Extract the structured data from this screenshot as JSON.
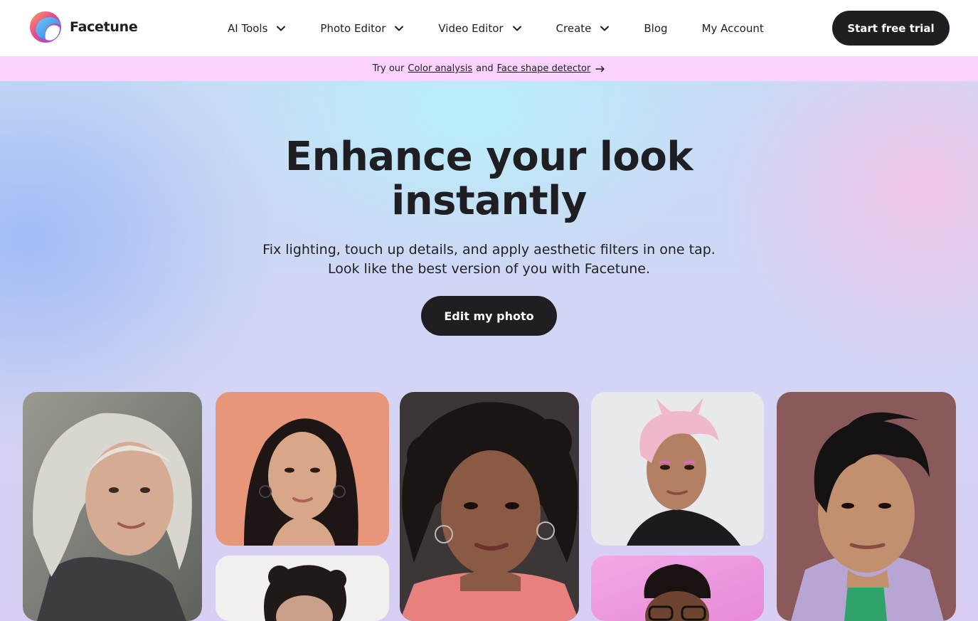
{
  "brand": {
    "name": "Facetune",
    "logo_icon": "facetune-logo-icon"
  },
  "nav": {
    "items": [
      {
        "label": "AI Tools",
        "has_dropdown": true
      },
      {
        "label": "Photo Editor",
        "has_dropdown": true
      },
      {
        "label": "Video Editor",
        "has_dropdown": true
      },
      {
        "label": "Create",
        "has_dropdown": true
      },
      {
        "label": "Blog",
        "has_dropdown": false
      },
      {
        "label": "My Account",
        "has_dropdown": false
      }
    ],
    "cta_label": "Start free trial"
  },
  "promo": {
    "prefix": "Try our",
    "link1": "Color analysis",
    "joiner": "and",
    "link2": "Face shape detector",
    "arrow_icon": "arrow-right-icon",
    "background": "#fbd3fc"
  },
  "hero": {
    "title_line1": "Enhance your look",
    "title_line2": "instantly",
    "subtitle_line1": "Fix lighting, touch up details, and apply aesthetic filters in one tap.",
    "subtitle_line2": "Look like the best version of you with Facetune.",
    "cta_label": "Edit my photo"
  },
  "photos": [
    {
      "name": "portrait-silver-haired-woman"
    },
    {
      "name": "portrait-woman-peach-background"
    },
    {
      "name": "portrait-curly-haired-person"
    },
    {
      "name": "portrait-woman-curly-hair-pink-shirt"
    },
    {
      "name": "portrait-pink-haired-person"
    },
    {
      "name": "portrait-man-glasses-pink-background"
    },
    {
      "name": "portrait-man-denim-jacket"
    }
  ],
  "colors": {
    "primary_dark": "#1f1f23",
    "promo_pink": "#fbd3fc",
    "white": "#ffffff"
  }
}
